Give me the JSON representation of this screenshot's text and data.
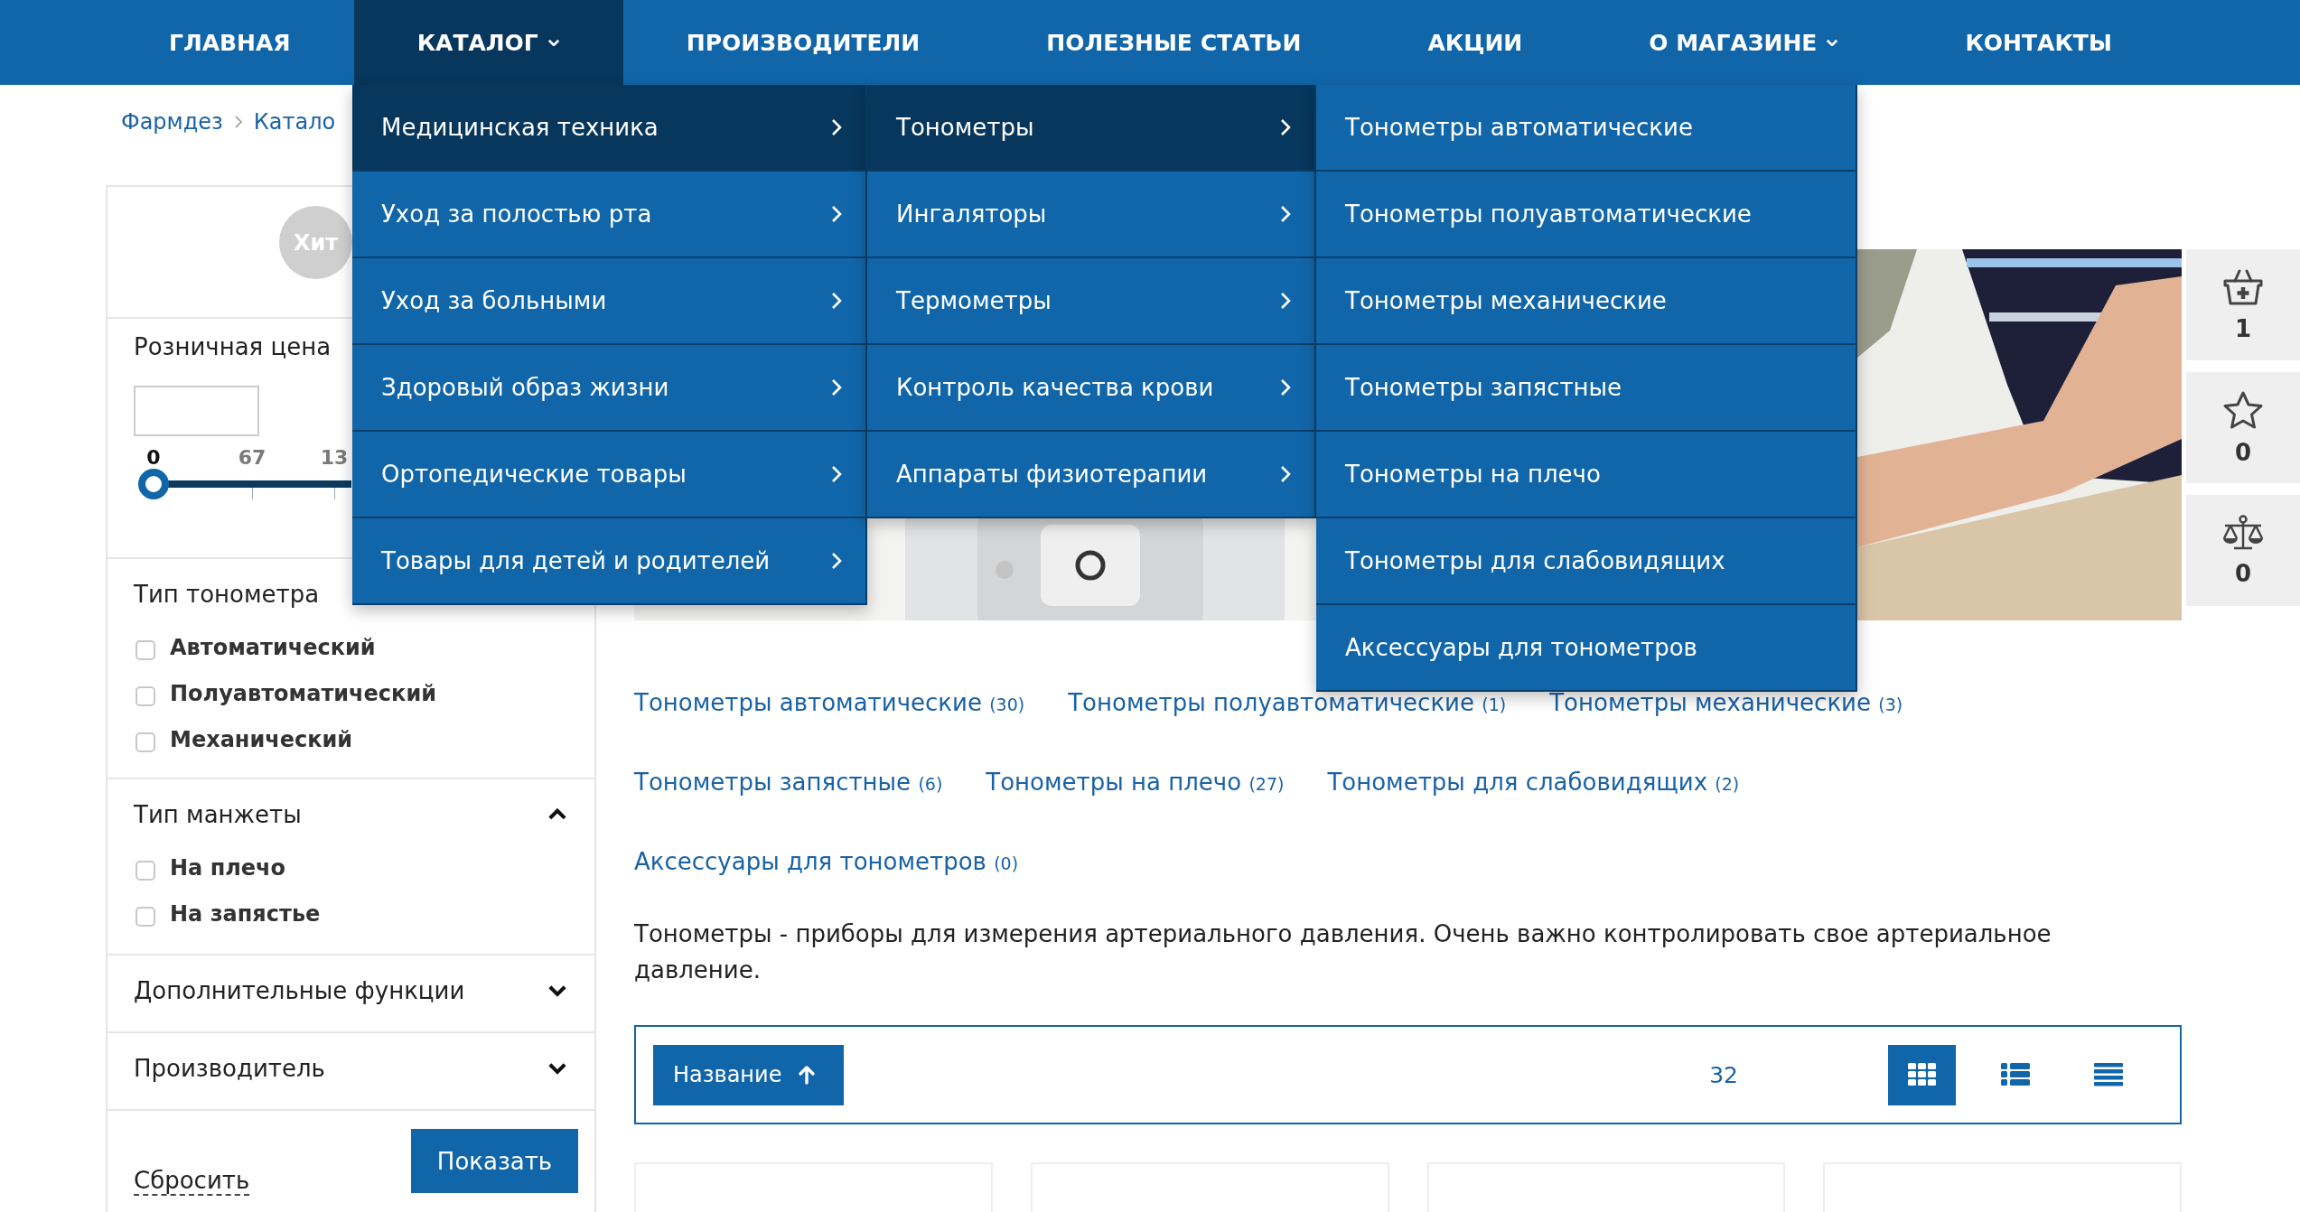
{
  "nav": [
    {
      "label": "ГЛАВНАЯ",
      "selected": false,
      "dropdown": false
    },
    {
      "label": "КАТАЛОГ",
      "selected": true,
      "dropdown": true
    },
    {
      "label": "ПРОИЗВОДИТЕЛИ",
      "selected": false,
      "dropdown": false
    },
    {
      "label": "ПОЛЕЗНЫЕ СТАТЬИ",
      "selected": false,
      "dropdown": false
    },
    {
      "label": "АКЦИИ",
      "selected": false,
      "dropdown": false
    },
    {
      "label": "О МАГАЗИНЕ",
      "selected": false,
      "dropdown": true
    },
    {
      "label": "КОНТАКТЫ",
      "selected": false,
      "dropdown": false
    }
  ],
  "mega_menu": {
    "columns": [
      {
        "items": [
          {
            "label": "Медицинская техника",
            "selected": true,
            "expandable": true
          },
          {
            "label": "Уход за полостью рта",
            "selected": false,
            "expandable": true
          },
          {
            "label": "Уход за больными",
            "selected": false,
            "expandable": true
          },
          {
            "label": "Здоровый образ жизни",
            "selected": false,
            "expandable": true
          },
          {
            "label": "Ортопедические товары",
            "selected": false,
            "expandable": true
          },
          {
            "label": "Товары для детей и родителей",
            "selected": false,
            "expandable": true
          }
        ]
      },
      {
        "items": [
          {
            "label": "Тонометры",
            "selected": true,
            "expandable": true
          },
          {
            "label": "Ингаляторы",
            "selected": false,
            "expandable": true
          },
          {
            "label": "Термометры",
            "selected": false,
            "expandable": true
          },
          {
            "label": "Контроль качества крови",
            "selected": false,
            "expandable": true
          },
          {
            "label": "Аппараты физиотерапии",
            "selected": false,
            "expandable": true
          }
        ]
      },
      {
        "items": [
          {
            "label": "Тонометры автоматические",
            "selected": false,
            "expandable": false
          },
          {
            "label": "Тонометры полуавтоматические",
            "selected": false,
            "expandable": false
          },
          {
            "label": "Тонометры механические",
            "selected": false,
            "expandable": false
          },
          {
            "label": "Тонометры запястные",
            "selected": false,
            "expandable": false
          },
          {
            "label": "Тонометры на плечо",
            "selected": false,
            "expandable": false
          },
          {
            "label": "Тонометры для слабовидящих",
            "selected": false,
            "expandable": false
          },
          {
            "label": "Аксессуары для тонометров",
            "selected": false,
            "expandable": false
          }
        ]
      }
    ]
  },
  "breadcrumbs": [
    "Фармдез",
    "Катало"
  ],
  "sidebar": {
    "badge": "Хит",
    "price": {
      "title": "Розничная цена",
      "level": 0,
      "labels": [
        {
          "text": "0",
          "active": true
        },
        {
          "text": "67",
          "active": false
        },
        {
          "text": "13",
          "active": false
        }
      ]
    },
    "filters": [
      {
        "title": "Тип тонометра",
        "options": [
          {
            "label": "Автоматический",
            "checked": false
          },
          {
            "label": "Полуавтоматический",
            "checked": false
          },
          {
            "label": "Механический",
            "checked": false
          }
        ]
      },
      {
        "title": "Тип манжеты",
        "expanded": true,
        "options": [
          {
            "label": "На плечо",
            "checked": false
          },
          {
            "label": "На запястье",
            "checked": false
          }
        ]
      },
      {
        "title": "Дополнительные функции",
        "expanded": false
      },
      {
        "title": "Производитель",
        "expanded": false
      }
    ],
    "reset": "Сбросить",
    "submit": "Показать"
  },
  "banner": {
    "kind": "picture"
  },
  "subcategory_rows": [
    [
      {
        "label": "Тонометры автоматические",
        "count": "(30)"
      },
      {
        "label": "Тонометры полуавтоматические",
        "count": "(1)"
      },
      {
        "label": "Тонометры механические",
        "count": "(3)"
      }
    ],
    [
      {
        "label": "Тонометры запястные",
        "count": "(6)"
      },
      {
        "label": "Тонометры на плечо",
        "count": "(27)"
      },
      {
        "label": "Тонометры для слабовидящих",
        "count": "(2)"
      }
    ],
    [
      {
        "label": "Аксессуары для тонометров",
        "count": "(0)"
      }
    ]
  ],
  "description": "Тонометры - приборы для измерения артериального давления. Очень важно контролировать свое артериальное давление.",
  "toolbar": {
    "sort": "Название",
    "per_page": "32",
    "views": [
      {
        "kind": "grid",
        "selected": true
      },
      {
        "kind": "list",
        "selected": false
      },
      {
        "kind": "table",
        "selected": false
      }
    ]
  },
  "products": [
    {
      "kind": "card"
    },
    {
      "kind": "card"
    },
    {
      "kind": "card"
    },
    {
      "kind": "card"
    }
  ],
  "side_widgets": [
    {
      "kind": "basket",
      "count": "1"
    },
    {
      "kind": "favorites",
      "count": "0"
    },
    {
      "kind": "compare",
      "count": "0"
    }
  ]
}
